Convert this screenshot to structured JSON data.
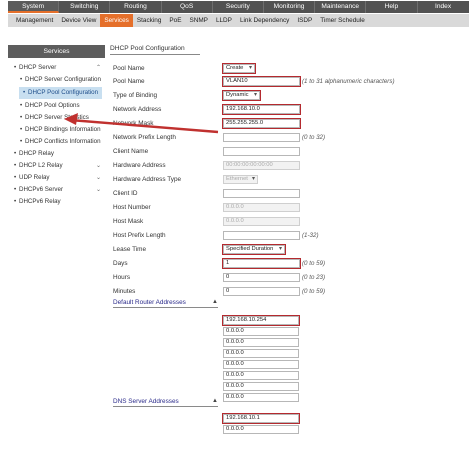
{
  "topnav": {
    "tabs": [
      "System",
      "Switching",
      "Routing",
      "QoS",
      "Security",
      "Monitoring",
      "Maintenance",
      "Help",
      "Index"
    ]
  },
  "subnav": {
    "items": [
      "Management",
      "Device View",
      "Services",
      "Stacking",
      "PoE",
      "SNMP",
      "LLDP",
      "Link Dependency",
      "ISDP",
      "Timer Schedule"
    ]
  },
  "sidebar": {
    "title": "Services",
    "items": [
      {
        "label": "DHCP Server",
        "bullet": "•"
      },
      {
        "label": "DHCP Server Configuration",
        "bullet": "•"
      },
      {
        "label": "DHCP Pool Configuration",
        "bullet": "•"
      },
      {
        "label": "DHCP Pool Options",
        "bullet": "•"
      },
      {
        "label": "DHCP Server Statistics",
        "bullet": "•"
      },
      {
        "label": "DHCP Bindings Information",
        "bullet": "•"
      },
      {
        "label": "DHCP Conflicts Information",
        "bullet": "•"
      },
      {
        "label": "DHCP Relay",
        "bullet": "•"
      },
      {
        "label": "DHCP L2 Relay",
        "bullet": "•"
      },
      {
        "label": "UDP Relay",
        "bullet": "•"
      },
      {
        "label": "DHCPv6 Server",
        "bullet": "•"
      },
      {
        "label": "DHCPv6 Relay",
        "bullet": "•"
      }
    ]
  },
  "main": {
    "title": "DHCP Pool Configuration",
    "fields": {
      "pool_name_sel": {
        "label": "Pool Name",
        "value": "Create"
      },
      "pool_name": {
        "label": "Pool Name",
        "value": "VLAN10",
        "hint": "(1 to 31 alphanumeric characters)"
      },
      "binding": {
        "label": "Type of Binding",
        "value": "Dynamic"
      },
      "net_addr": {
        "label": "Network Address",
        "value": "192.168.10.0"
      },
      "net_mask": {
        "label": "Network Mask",
        "value": "255.255.255.0"
      },
      "prefix": {
        "label": "Network Prefix Length",
        "value": "",
        "hint": "(0 to 32)"
      },
      "client_name": {
        "label": "Client Name",
        "value": ""
      },
      "hw_addr": {
        "label": "Hardware Address",
        "value": "00:00:00:00:00:00"
      },
      "hw_type": {
        "label": "Hardware Address Type",
        "value": "Ethernet"
      },
      "client_id": {
        "label": "Client ID",
        "value": ""
      },
      "host_num": {
        "label": "Host Number",
        "value": "0.0.0.0"
      },
      "host_mask": {
        "label": "Host Mask",
        "value": "0.0.0.0"
      },
      "host_prefix": {
        "label": "Host Prefix Length",
        "value": "",
        "hint": "(1-32)"
      },
      "lease": {
        "label": "Lease Time",
        "value": "Specified Duration"
      },
      "days": {
        "label": "Days",
        "value": "1",
        "hint": "(0 to 59)"
      },
      "hours": {
        "label": "Hours",
        "value": "0",
        "hint": "(0 to 23)"
      },
      "minutes": {
        "label": "Minutes",
        "value": "0",
        "hint": "(0 to 59)"
      }
    },
    "default_router": {
      "title": "Default Router Addresses",
      "caret": "▲",
      "values": [
        "192.168.10.254",
        "0.0.0.0",
        "0.0.0.0",
        "0.0.0.0",
        "0.0.0.0",
        "0.0.0.0",
        "0.0.0.0",
        "0.0.0.0"
      ]
    },
    "dns": {
      "title": "DNS Server Addresses",
      "caret": "▲",
      "values": [
        "192.168.10.1",
        "0.0.0.0"
      ]
    }
  },
  "colors": {
    "highlight": "#b42a2f",
    "accent": "#e56f2a",
    "menu_bg": "#525252"
  }
}
